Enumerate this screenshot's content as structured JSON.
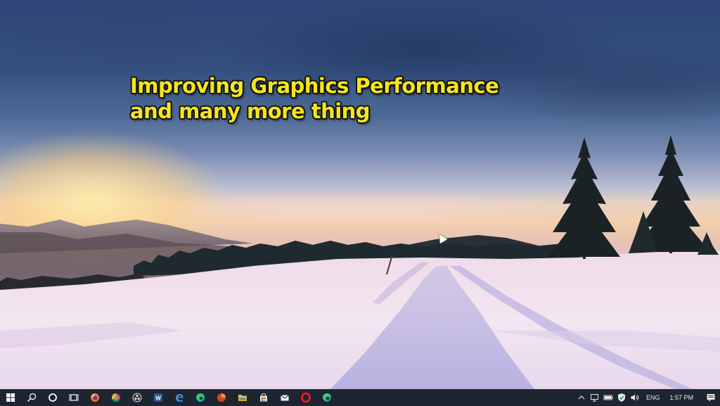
{
  "overlay": {
    "line1": "Improving Graphics Performance",
    "line2": "and many more thing"
  },
  "taskbar": {
    "items": [
      {
        "name": "start",
        "icon": "windows-logo-icon"
      },
      {
        "name": "search",
        "icon": "search-icon"
      },
      {
        "name": "cortana",
        "icon": "cortana-circle-icon"
      },
      {
        "name": "task-view",
        "icon": "task-view-icon"
      },
      {
        "name": "firefox",
        "icon": "firefox-icon"
      },
      {
        "name": "chrome",
        "icon": "chrome-icon"
      },
      {
        "name": "obs",
        "icon": "obs-icon"
      },
      {
        "name": "word",
        "icon": "word-icon"
      },
      {
        "name": "edge-legacy",
        "icon": "edge-legacy-icon"
      },
      {
        "name": "edge",
        "icon": "edge-icon"
      },
      {
        "name": "powerpoint",
        "icon": "powerpoint-icon"
      },
      {
        "name": "file-explorer",
        "icon": "folder-icon"
      },
      {
        "name": "store",
        "icon": "store-bag-icon"
      },
      {
        "name": "mail",
        "icon": "mail-icon"
      },
      {
        "name": "opera",
        "icon": "opera-icon"
      },
      {
        "name": "edge-dev",
        "icon": "edge-dev-icon"
      }
    ],
    "tray": {
      "icons": [
        "chevron-up-icon",
        "network-icon",
        "battery-icon",
        "security-shield-icon",
        "volume-icon"
      ],
      "language": "ENG",
      "time": "1:57 PM",
      "notification_icon": "notification-icon"
    }
  }
}
